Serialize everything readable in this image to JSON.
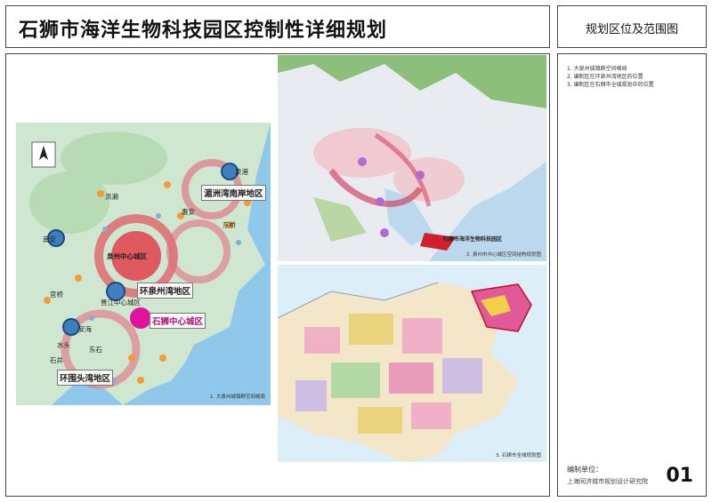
{
  "header": {
    "title": "石狮市海洋生物科技园区控制性详细规划",
    "side_title": "规划区位及范围图"
  },
  "notes": [
    "1. 大泉州城镇群空间格局",
    "2. 编制区在环泉州湾地区的位置",
    "3. 编制区在石狮市全域规划中的位置"
  ],
  "map1": {
    "caption": "1. 大泉州城镇群空间格局",
    "regions": {
      "meizhou": "湄洲湾南岸地区",
      "huanquanzhou": "环泉州湾地区",
      "shishi_center": "石狮中心城区",
      "huanweitou": "环围头湾地区"
    },
    "places": {
      "quanzhou_center": "泉州中心城区",
      "jinjiang_center": "晋江中心城区",
      "nanan": "南安",
      "hongla": "洪濑",
      "huian": "惠安",
      "quangang": "泉港",
      "dongqiao": "东桥",
      "guanqiao": "官桥",
      "anhai": "安海",
      "dongshi": "东石",
      "shuitou": "水头",
      "shijing": "石井"
    }
  },
  "map2": {
    "caption": "2. 泉州市中心城区空间结构规划图",
    "site_label": "石狮市海洋生物科技园区"
  },
  "map3": {
    "caption": "3. 石狮市全域规划图"
  },
  "footer": {
    "label": "编制单位：",
    "org": "上海同济城市规划设计研究院",
    "page": "01"
  }
}
